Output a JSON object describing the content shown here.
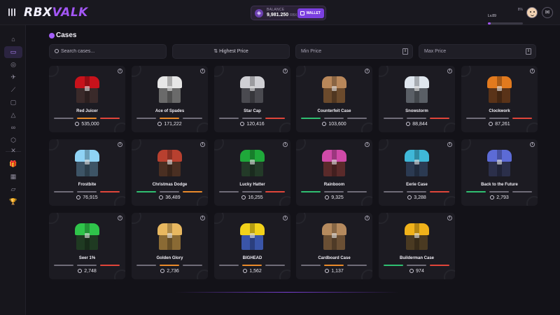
{
  "app": {
    "logo_part1": "RBX",
    "logo_part2": "VALK"
  },
  "header": {
    "balance_label": "BALANCE",
    "balance_value": "9,981.250",
    "balance_unit": "RBX",
    "wallet_label": "WALLET",
    "level": "Lv.89",
    "level_pct": "8%",
    "level_progress": 0.08
  },
  "sidebar": {
    "icons": [
      "home-icon",
      "cases-icon",
      "coinflip-icon",
      "rocket-icon",
      "chart-icon",
      "dice-icon",
      "triangle-icon",
      "infinity-icon",
      "cube-icon",
      "crossed-swords-icon",
      "gift-icon",
      "calendar-icon",
      "ticket-icon",
      "trophy-icon"
    ],
    "glyphs": [
      "⌂",
      "▭",
      "◎",
      "✈",
      "⟋",
      "▢",
      "△",
      "∞",
      "⬡",
      "✕",
      "🎁",
      "▦",
      "▱",
      "🏆"
    ],
    "active_index": 1
  },
  "page": {
    "title": "Cases"
  },
  "filters": {
    "search_placeholder": "Search cases...",
    "sort_label": "Highest Price",
    "min_price": "Min Price",
    "max_price": "Max Price"
  },
  "rarity_colors": {
    "gray": "#6f6c78",
    "orange": "#e98a2b",
    "red": "#e0453a",
    "green": "#2fbf71"
  },
  "cases": [
    {
      "name": "Red Juicer",
      "price": "535,000",
      "lid": "#c8121b",
      "box": "#3a2a2a",
      "bars": [
        "gray",
        "orange",
        "red"
      ]
    },
    {
      "name": "Ace of Spades",
      "price": "171,222",
      "lid": "#e6e6e6",
      "box": "#6a6a6a",
      "bars": [
        "gray",
        "orange",
        "gray"
      ]
    },
    {
      "name": "Star Cap",
      "price": "120,416",
      "lid": "#cfcfd4",
      "box": "#4a4a50",
      "bars": [
        "gray",
        "gray",
        "red"
      ]
    },
    {
      "name": "Counterfeit Case",
      "price": "103,600",
      "lid": "#b8875a",
      "box": "#6b4a2c",
      "bars": [
        "green",
        "gray",
        "gray"
      ]
    },
    {
      "name": "Snowstorm",
      "price": "88,844",
      "lid": "#dfe6ee",
      "box": "#5a5f66",
      "bars": [
        "gray",
        "gray",
        "red"
      ]
    },
    {
      "name": "Clockwork",
      "price": "87,261",
      "lid": "#e27a1e",
      "box": "#5a3318",
      "bars": [
        "gray",
        "gray",
        "red"
      ]
    },
    {
      "name": "Frostbite",
      "price": "76,915",
      "lid": "#8fd3f5",
      "box": "#3d5466",
      "bars": [
        "gray",
        "gray",
        "red"
      ]
    },
    {
      "name": "Christmas Dodge",
      "price": "36,489",
      "lid": "#b8402f",
      "box": "#4a2f22",
      "bars": [
        "green",
        "gray",
        "orange"
      ]
    },
    {
      "name": "Lucky Hatter",
      "price": "16,255",
      "lid": "#1fa83a",
      "box": "#233a28",
      "bars": [
        "gray",
        "gray",
        "red"
      ]
    },
    {
      "name": "Rainboom",
      "price": "9,325",
      "lid": "#d04aa8",
      "box": "#5a2a2a",
      "bars": [
        "green",
        "gray",
        "gray"
      ]
    },
    {
      "name": "Eerie Case",
      "price": "3,288",
      "lid": "#3fb8d8",
      "box": "#2b3a52",
      "bars": [
        "gray",
        "gray",
        "red"
      ]
    },
    {
      "name": "Back to the Future",
      "price": "2,793",
      "lid": "#5c6bd6",
      "box": "#2b2f4a",
      "bars": [
        "green",
        "gray",
        "gray"
      ]
    },
    {
      "name": "Seer 1%",
      "price": "2,748",
      "lid": "#2fc44a",
      "box": "#1f3a22",
      "bars": [
        "gray",
        "gray",
        "red"
      ]
    },
    {
      "name": "Golden Glory",
      "price": "2,736",
      "lid": "#e8b860",
      "box": "#8a6a34",
      "bars": [
        "gray",
        "orange",
        "gray"
      ]
    },
    {
      "name": "BIGHEAD",
      "price": "1,562",
      "lid": "#f2d21a",
      "box": "#3a55a8",
      "bars": [
        "gray",
        "orange",
        "gray"
      ]
    },
    {
      "name": "Cardboard Case",
      "price": "1,137",
      "lid": "#b58a5e",
      "box": "#6a4f34",
      "bars": [
        "gray",
        "orange",
        "gray"
      ]
    },
    {
      "name": "Builderman Case",
      "price": "974",
      "lid": "#f0b21a",
      "box": "#4a3a22",
      "bars": [
        "green",
        "gray",
        "red"
      ]
    }
  ]
}
